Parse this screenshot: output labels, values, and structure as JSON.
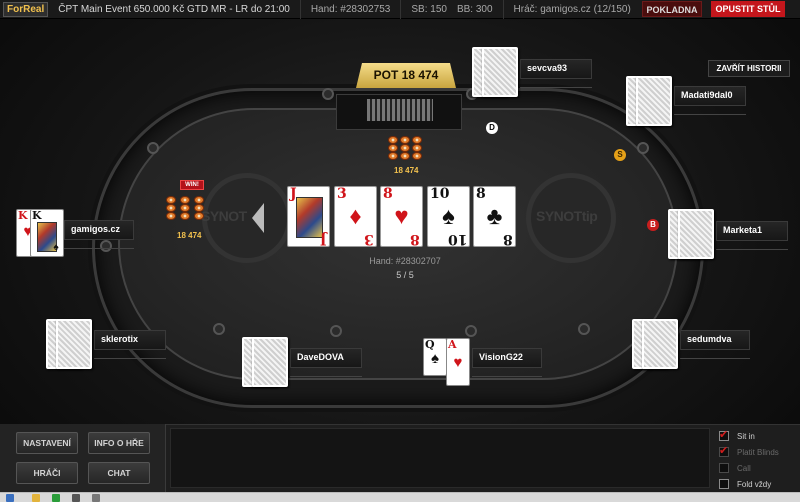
{
  "header": {
    "mode": "ForReal",
    "title": "ČPT Main Event 650.000 Kč GTD MR - LR do 21:00",
    "hand": "Hand: #28302753",
    "sb": "SB: 150",
    "bb": "BB: 300",
    "player": "Hráč: gamigos.cz (12/150)",
    "cashier_label": "POKLADNA",
    "leave_label": "OPUSTIT STŮL"
  },
  "table": {
    "pot_label": "POT 18 474",
    "center_chips_amount": "18 474",
    "hand_info": "Hand: #28302707",
    "hand_counter": "5 / 5",
    "logo_left": "SYNOT",
    "logo_right": "SYNOTtip",
    "win_badge": "WIN!",
    "dealer_button": "D",
    "small_blind_button": "S",
    "big_blind_button": "B",
    "board": [
      {
        "rank": "J",
        "suit": "♥",
        "color": "red",
        "face": true
      },
      {
        "rank": "3",
        "suit": "♦",
        "color": "red",
        "face": false
      },
      {
        "rank": "8",
        "suit": "♥",
        "color": "red",
        "face": false
      },
      {
        "rank": "10",
        "suit": "♠",
        "color": "black",
        "face": false
      },
      {
        "rank": "8",
        "suit": "♣",
        "color": "black",
        "face": false
      }
    ]
  },
  "players": {
    "gamigos": {
      "name": "gamigos.cz",
      "chips": "18 474",
      "card1_rank": "K",
      "card1_suit": "♥",
      "card2_rank": "K",
      "card2_suit": "♠"
    },
    "sevcva93": {
      "name": "sevcva93"
    },
    "madati": {
      "name": "Madati9dal0"
    },
    "marketa": {
      "name": "Marketa1"
    },
    "sklerotix": {
      "name": "sklerotix"
    },
    "davedova": {
      "name": "DaveDOVA"
    },
    "visiong22": {
      "name": "VisionG22",
      "card1_rank": "Q",
      "card1_suit": "♠",
      "card2_rank": "A",
      "card2_suit": "♥"
    },
    "sedumdva": {
      "name": "sedumdva"
    }
  },
  "history_button": "ZAVŘÍT HISTORII",
  "controls": {
    "settings": "NASTAVENÍ",
    "game_info": "INFO O HŘE",
    "players": "HRÁČI",
    "chat": "CHAT"
  },
  "options": {
    "sit_in": "Sit in",
    "post_blinds": "Platit Blinds",
    "call": "Call",
    "fold_always": "Fold vždy"
  },
  "colors": {
    "accent_red": "#c4161c",
    "pot_gold": "#e2c25a",
    "chip_orange": "#e07b2a"
  }
}
